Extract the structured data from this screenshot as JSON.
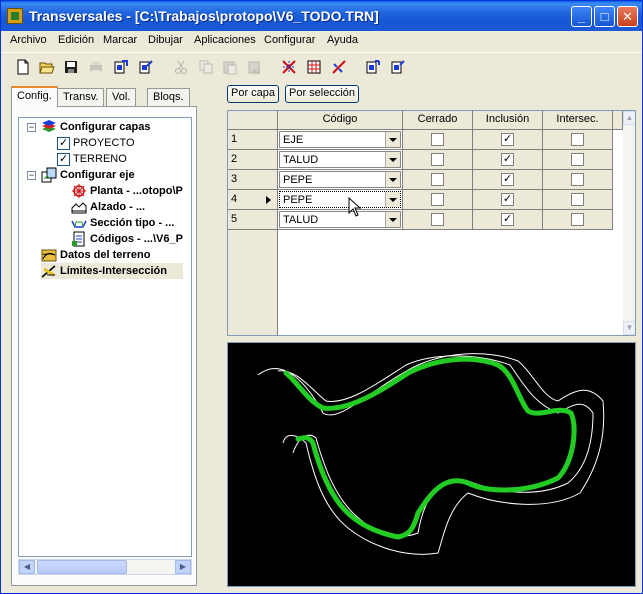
{
  "window": {
    "title": "Transversales - [C:\\Trabajos\\protopo\\V6_TODO.TRN]",
    "controls": {
      "minimize": "_",
      "maximize": "□",
      "close": "✕"
    }
  },
  "menu": [
    "Archivo",
    "Edición",
    "Marcar",
    "Dibujar",
    "Aplicaciones",
    "Configurar",
    "Ayuda"
  ],
  "toolbar": {
    "icons": [
      "new-file-icon",
      "open-folder-icon",
      "save-icon",
      "print-icon",
      "export-icon",
      "import-icon",
      "cut-icon",
      "copy-icon",
      "paste-icon",
      "paste-special-icon",
      "crossing-icon",
      "grid-report-icon",
      "curve-icon",
      "layer-export-icon",
      "layer-import-icon"
    ]
  },
  "tabs": [
    "Config.",
    "Transv.",
    "Vol.",
    "Bloqs."
  ],
  "tree": {
    "configurar_capas": "Configurar capas",
    "proyecto": "PROYECTO",
    "terreno": "TERRENO",
    "configurar_eje": "Configurar eje",
    "planta": "Planta - ...otopo\\P",
    "alzado": "Alzado - ...",
    "seccion_tipo": "Sección tipo - ...",
    "codigos": "Códigos - ...\\V6_P",
    "datos_terreno": "Datos del terreno",
    "limites": "Límites-Intersección",
    "expander_symbol": "−"
  },
  "buttons": {
    "por_capa": "Por capa",
    "por_seleccion": "Por selección"
  },
  "grid": {
    "headers": {
      "codigo": "Código",
      "cerrado": "Cerrado",
      "inclusion": "Inclusión",
      "intersec": "Intersec."
    },
    "rows": [
      {
        "num": "1",
        "codigo": "EJE",
        "cerrado": false,
        "inclusion": true,
        "intersec": false
      },
      {
        "num": "2",
        "codigo": "TALUD",
        "cerrado": false,
        "inclusion": true,
        "intersec": false
      },
      {
        "num": "3",
        "codigo": "PEPE",
        "cerrado": false,
        "inclusion": true,
        "intersec": false
      },
      {
        "num": "4",
        "codigo": "PEPE",
        "cerrado": false,
        "inclusion": true,
        "intersec": false
      },
      {
        "num": "5",
        "codigo": "TALUD",
        "cerrado": false,
        "inclusion": true,
        "intersec": false
      }
    ],
    "current_row": 4
  },
  "colors": {
    "axis_line": "#22cc22",
    "boundary_line": "#ffffff",
    "canvas_bg": "#000000",
    "title_bar": "#1657d4"
  }
}
